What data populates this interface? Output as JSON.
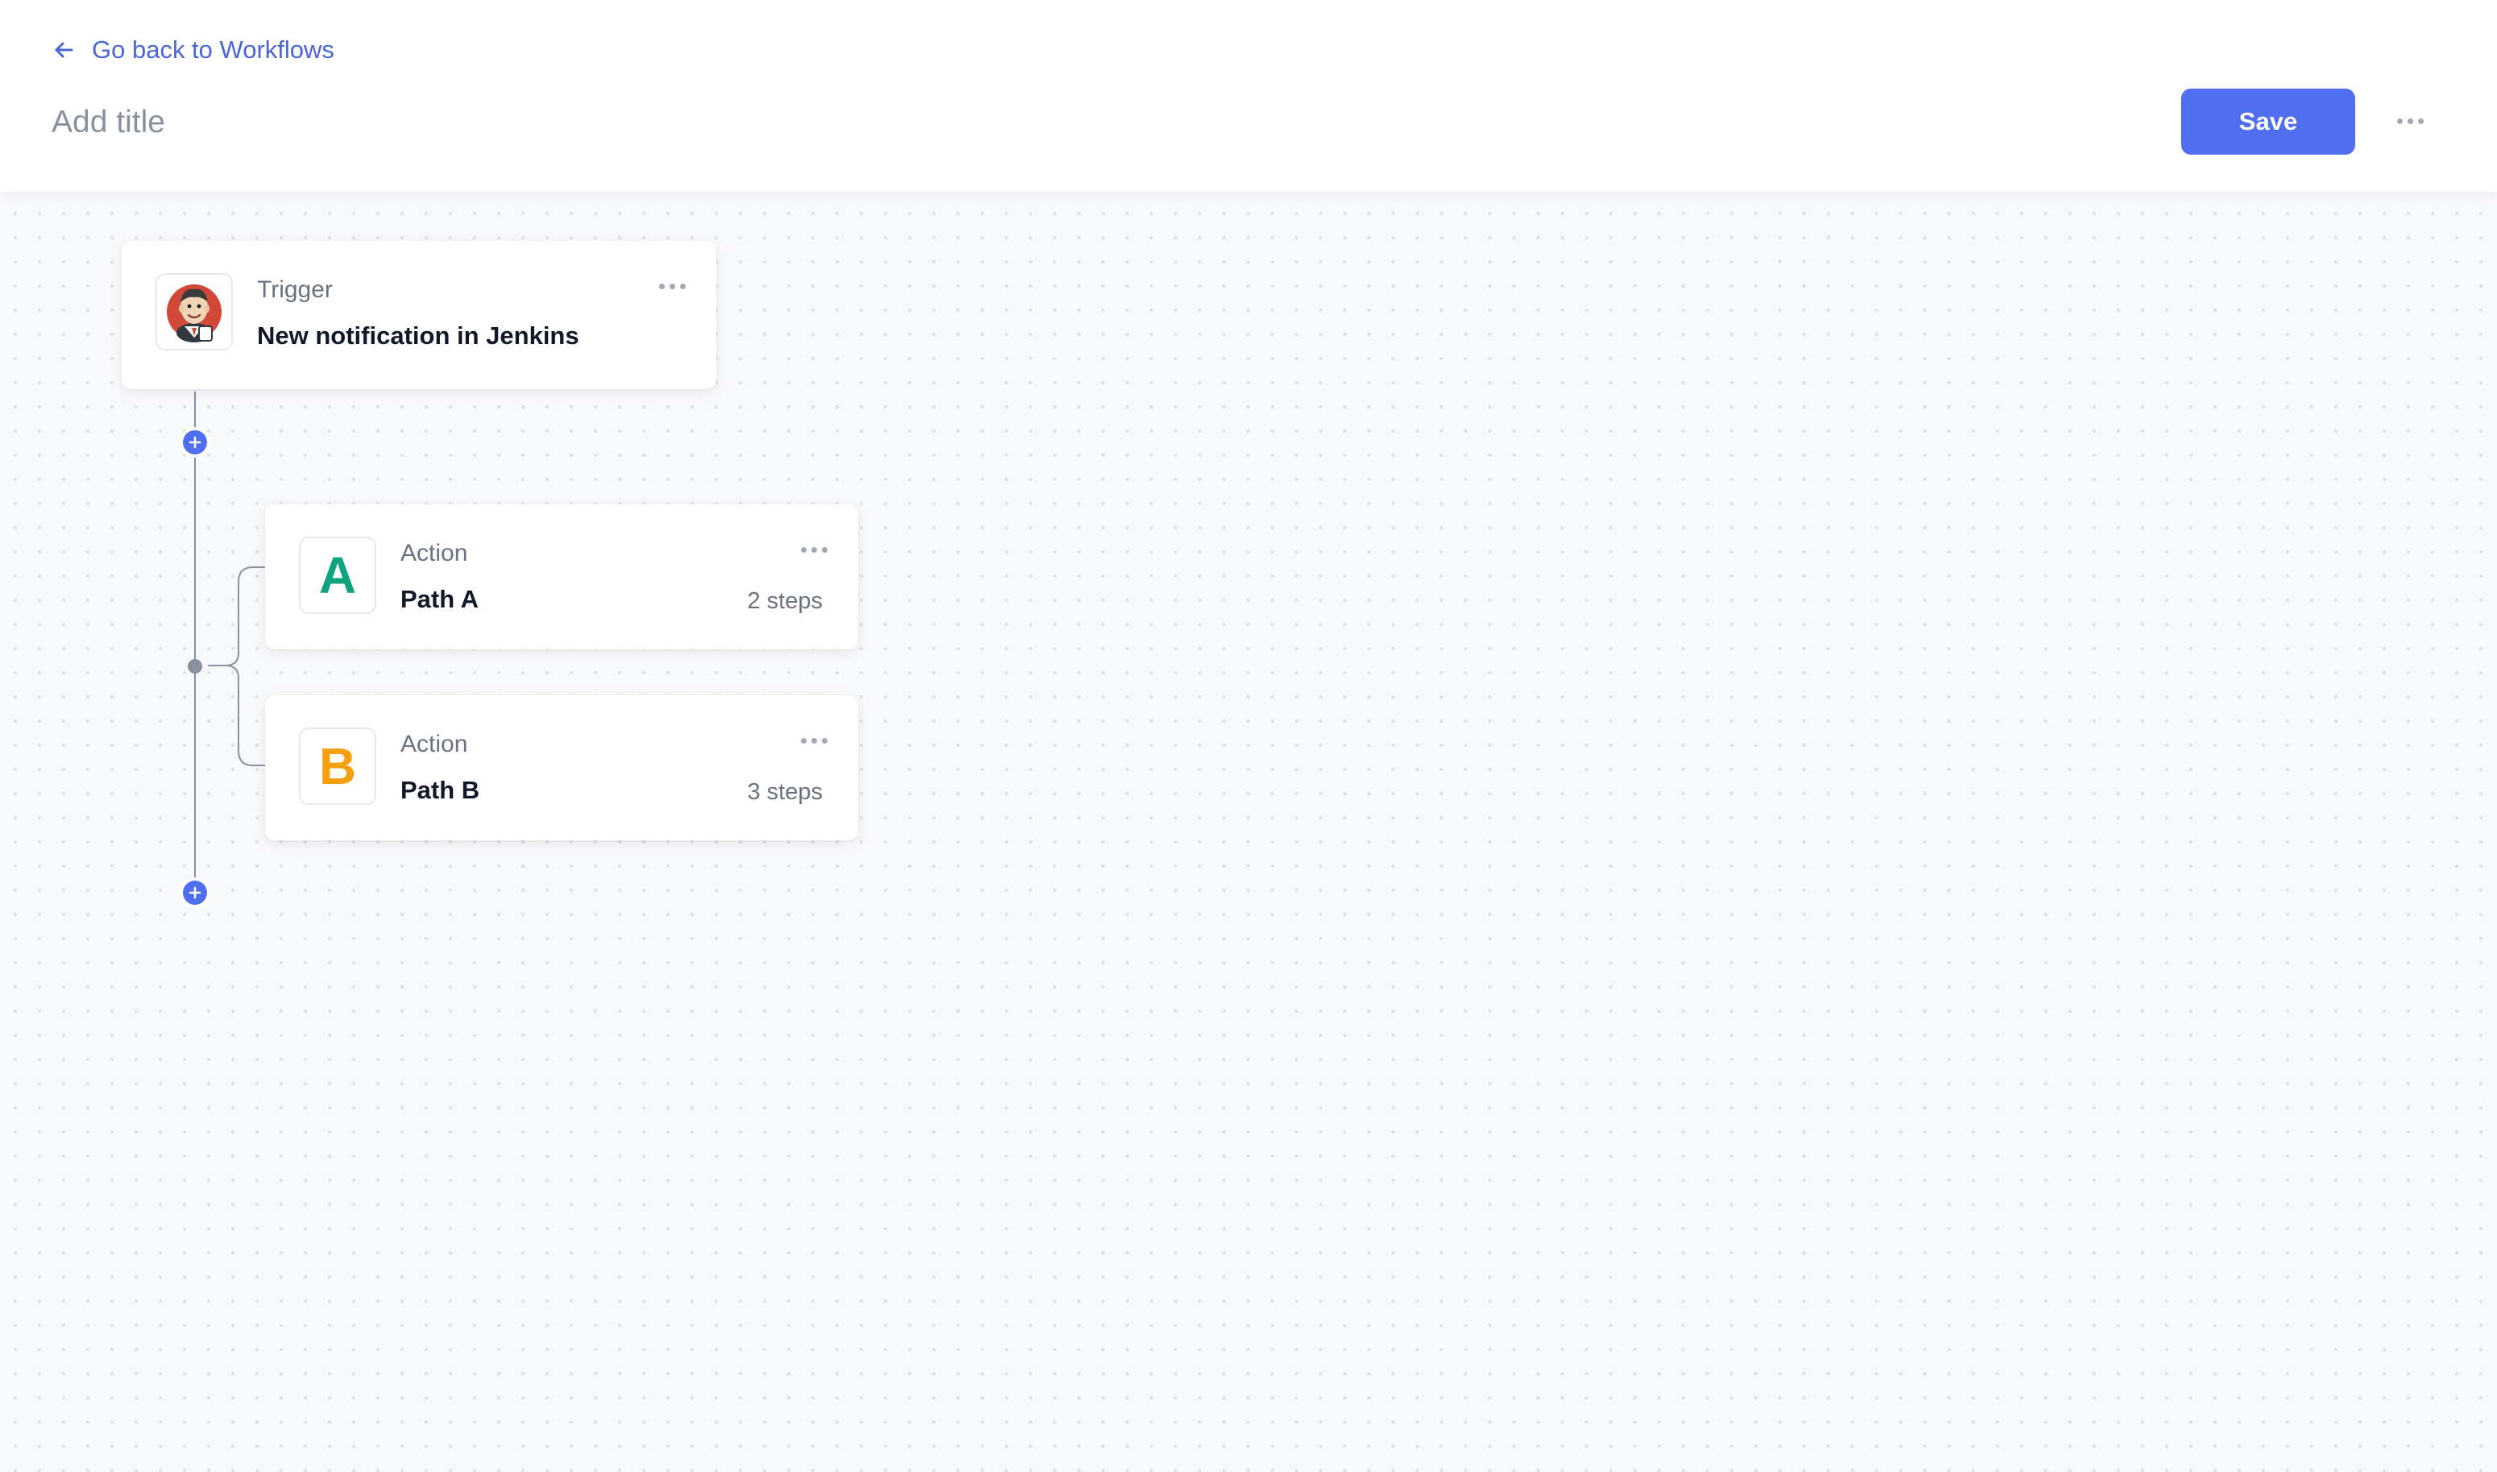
{
  "header": {
    "back_label": "Go back to Workflows",
    "title_placeholder": "Add title",
    "title_value": "",
    "save_label": "Save"
  },
  "workflow": {
    "trigger": {
      "kind": "Trigger",
      "name": "New notification in Jenkins",
      "icon": "jenkins-logo"
    },
    "paths": [
      {
        "kind": "Action",
        "letter": "A",
        "name": "Path A",
        "steps": "2 steps",
        "color": "#10a37f"
      },
      {
        "kind": "Action",
        "letter": "B",
        "name": "Path B",
        "steps": "3 steps",
        "color": "#f5a00f"
      }
    ]
  },
  "colors": {
    "accent": "#4f6ff0",
    "link": "#4a66d8",
    "connector": "#8a919e"
  }
}
